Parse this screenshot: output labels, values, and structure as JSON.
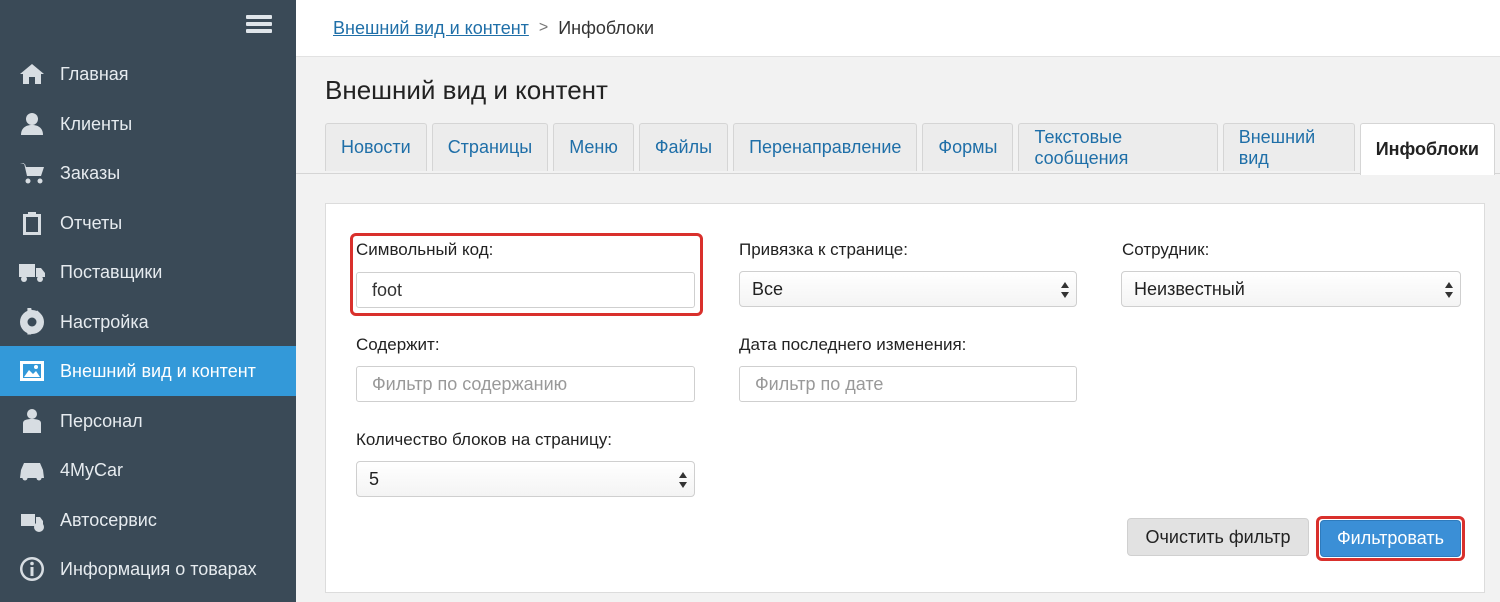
{
  "sidebar": {
    "items": [
      {
        "label": "Главная",
        "icon": "home-icon"
      },
      {
        "label": "Клиенты",
        "icon": "clients-icon"
      },
      {
        "label": "Заказы",
        "icon": "cart-icon"
      },
      {
        "label": "Отчеты",
        "icon": "clipboard-icon"
      },
      {
        "label": "Поставщики",
        "icon": "truck-icon"
      },
      {
        "label": "Настройка",
        "icon": "gear-icon"
      },
      {
        "label": "Внешний вид и контент",
        "icon": "image-icon",
        "active": true
      },
      {
        "label": "Персонал",
        "icon": "staff-icon"
      },
      {
        "label": "4MyCar",
        "icon": "car-icon"
      },
      {
        "label": "Автосервис",
        "icon": "service-icon"
      },
      {
        "label": "Информация о товарах",
        "icon": "info-icon"
      }
    ]
  },
  "breadcrumb": {
    "parent": "Внешний вид и контент",
    "separator": ">",
    "current": "Инфоблоки"
  },
  "page_title": "Внешний вид и контент",
  "tabs": [
    "Новости",
    "Страницы",
    "Меню",
    "Файлы",
    "Перенаправление",
    "Формы",
    "Текстовые сообщения",
    "Внешний вид",
    "Инфоблоки"
  ],
  "active_tab": "Инфоблоки",
  "filter": {
    "symbol_code_label": "Символьный код:",
    "symbol_code_value": "foot",
    "page_binding_label": "Привязка к странице:",
    "page_binding_value": "Все",
    "employee_label": "Сотрудник:",
    "employee_value": "Неизвестный",
    "contains_label": "Содержит:",
    "contains_placeholder": "Фильтр по содержанию",
    "date_label": "Дата последнего изменения:",
    "date_placeholder": "Фильтр по дате",
    "per_page_label": "Количество блоков на страницу:",
    "per_page_value": "5",
    "clear_button": "Очистить фильтр",
    "filter_button": "Фильтровать"
  },
  "colors": {
    "sidebar_bg": "#3a4a57",
    "active_item": "#3399d9",
    "link": "#1f6fa8",
    "highlight": "#d9302c",
    "primary_button": "#3b8fd6"
  }
}
